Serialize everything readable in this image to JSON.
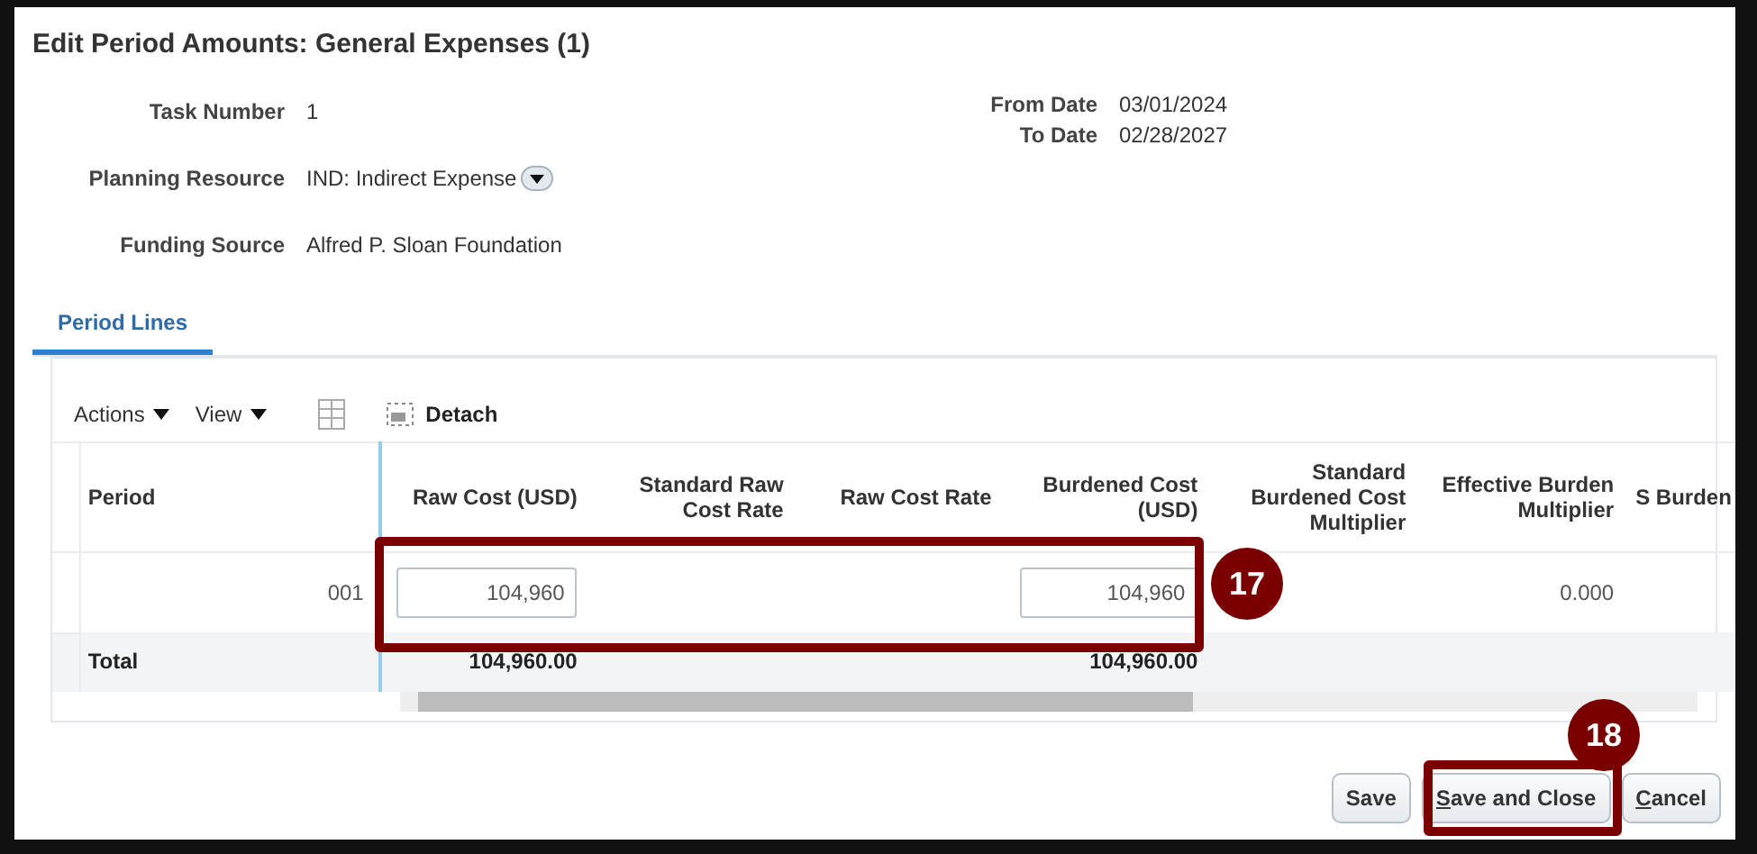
{
  "dialog": {
    "title": "Edit Period Amounts: General Expenses (1)"
  },
  "fields_left": [
    {
      "label": "Task Number",
      "value": "1",
      "dropdown": false
    },
    {
      "label": "Planning Resource",
      "value": "IND: Indirect Expense",
      "dropdown": true
    },
    {
      "label": "Funding Source",
      "value": "Alfred P. Sloan Foundation",
      "dropdown": false
    }
  ],
  "fields_right": [
    {
      "label": "From Date",
      "value": "03/01/2024"
    },
    {
      "label": "To Date",
      "value": "02/28/2027"
    }
  ],
  "tabs": [
    {
      "label": "Period Lines",
      "selected": true
    }
  ],
  "toolbar": {
    "menus": [
      "Actions",
      "View"
    ],
    "detach": "Detach"
  },
  "table": {
    "columns": [
      "Period",
      "Raw Cost (USD)",
      "Standard Raw Cost Rate",
      "Raw Cost Rate",
      "Burdened Cost (USD)",
      "Standard Burdened Cost Multiplier",
      "Effective Burden Multiplier",
      "S Burden"
    ],
    "rows": [
      {
        "cells": [
          {
            "kind": "text",
            "value": "001"
          },
          {
            "kind": "input",
            "value": "104,960"
          },
          {
            "kind": "text"
          },
          {
            "kind": "text"
          },
          {
            "kind": "input",
            "value": "104,960"
          },
          {
            "kind": "text"
          },
          {
            "kind": "text",
            "value": "0.000"
          },
          {
            "kind": "text"
          }
        ]
      }
    ],
    "total": {
      "label": "Total",
      "raw_cost": "104,960.00",
      "burdened_cost": "104,960.00"
    }
  },
  "buttons": [
    {
      "rest": "Save"
    },
    {
      "mnemonic": "S",
      "rest": "ave and Close"
    },
    {
      "mnemonic": "C",
      "rest": "ancel"
    }
  ],
  "callouts": [
    "17",
    "18"
  ]
}
